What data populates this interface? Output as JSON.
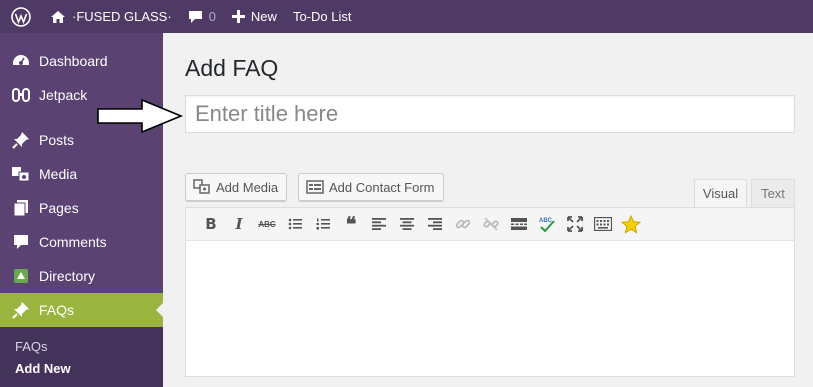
{
  "adminbar": {
    "site_name": "·FUSED GLASS·",
    "comments_count": "0",
    "new_label": "New",
    "todo_label": "To-Do List"
  },
  "sidebar": {
    "items": [
      {
        "label": "Dashboard",
        "icon": "dashboard-icon"
      },
      {
        "label": "Jetpack",
        "icon": "jetpack-icon"
      },
      {
        "label": "Posts",
        "icon": "pin-icon"
      },
      {
        "label": "Media",
        "icon": "media-icon"
      },
      {
        "label": "Pages",
        "icon": "pages-icon"
      },
      {
        "label": "Comments",
        "icon": "comment-icon"
      },
      {
        "label": "Directory",
        "icon": "directory-icon"
      },
      {
        "label": "FAQs",
        "icon": "pin-icon",
        "active": true
      }
    ],
    "submenu": [
      {
        "label": "FAQs"
      },
      {
        "label": "Add New"
      }
    ]
  },
  "main": {
    "page_title": "Add FAQ",
    "title_placeholder": "Enter title here",
    "add_media_label": "Add Media",
    "add_contact_form_label": "Add Contact Form",
    "tabs": [
      {
        "label": "Visual",
        "active": true
      },
      {
        "label": "Text",
        "active": false
      }
    ]
  },
  "toolbar": {
    "bold": "B",
    "italic": "I",
    "strike": "ABC",
    "blockquote": "❝"
  },
  "colors": {
    "adminbar_bg": "#4f3a66",
    "sidebar_bg": "#5a4273",
    "active_item": "#9ab53f",
    "submenu_bg": "#43325a"
  }
}
